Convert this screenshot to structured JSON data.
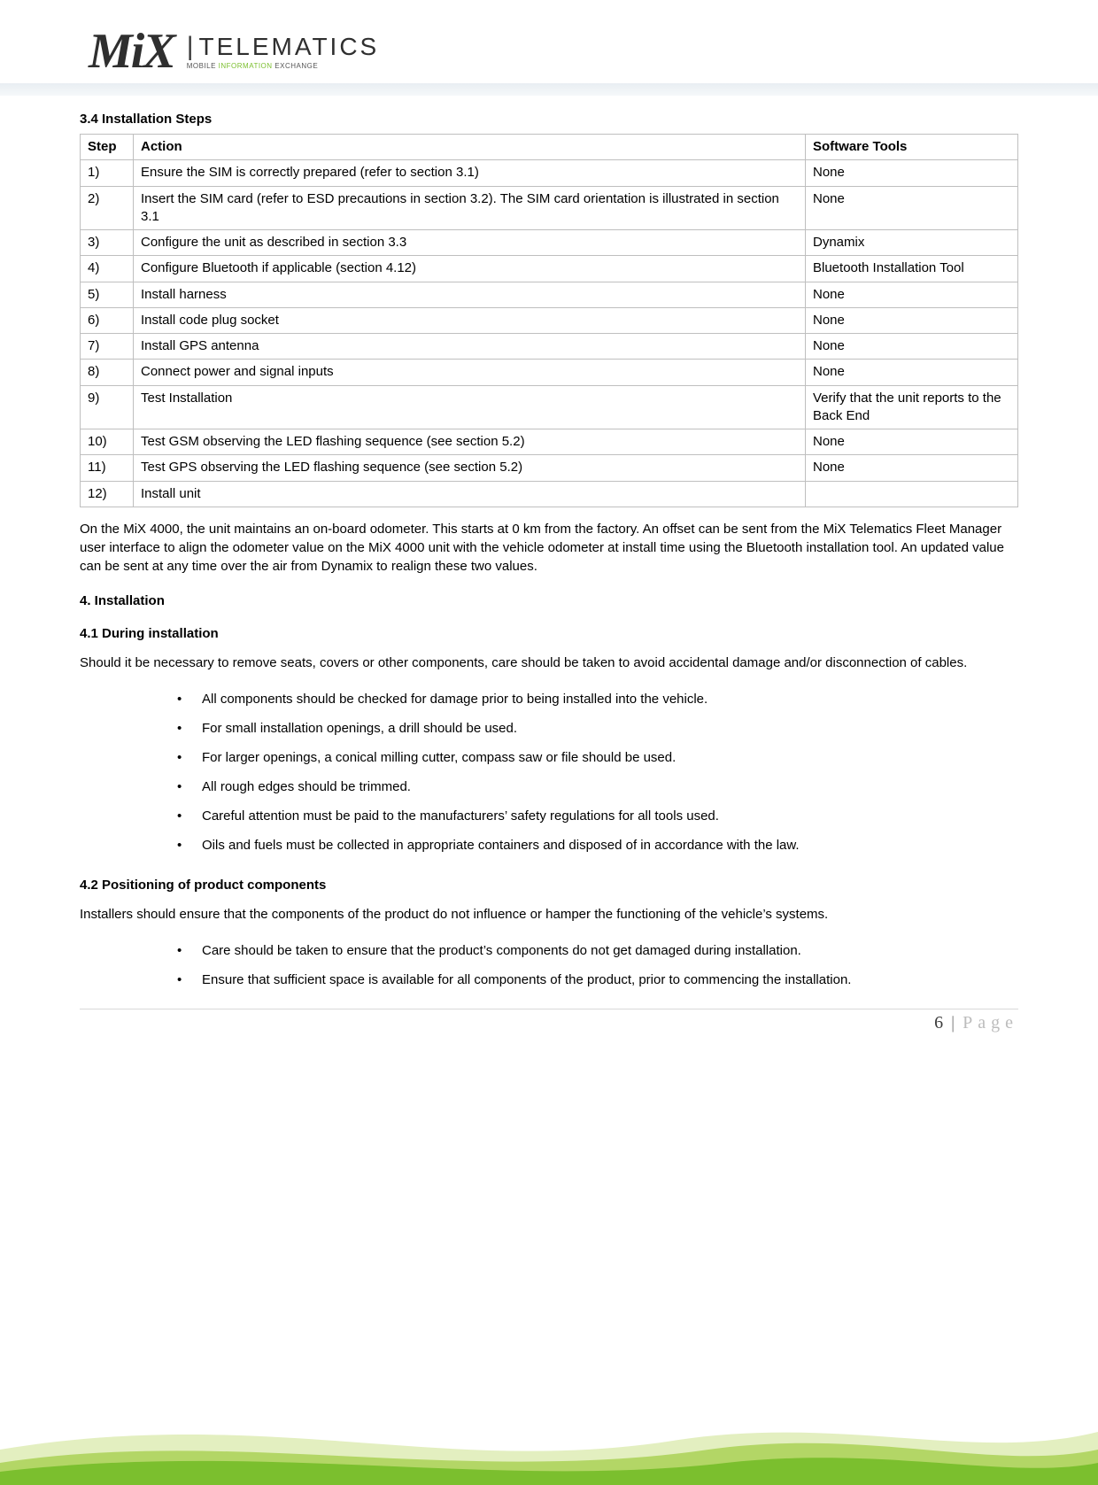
{
  "logo": {
    "mix": "MiX",
    "telematics": "TELEMATICS",
    "tagline_pre": "MOBILE ",
    "tagline_green": "INFORMATION",
    "tagline_post": " EXCHANGE"
  },
  "section_3_4": {
    "heading": "3.4  Installation Steps",
    "columns": {
      "step": "Step",
      "action": "Action",
      "tool": "Software Tools"
    },
    "rows": [
      {
        "step": "1)",
        "action": "Ensure the SIM is correctly prepared (refer to section 3.1)",
        "tool": "None"
      },
      {
        "step": "2)",
        "action": "Insert the SIM card (refer to ESD precautions in section 3.2).  The SIM card orientation is illustrated in section 3.1",
        "tool": "None"
      },
      {
        "step": "3)",
        "action": "Configure the unit as described in section 3.3",
        "tool": "Dynamix"
      },
      {
        "step": "4)",
        "action": "Configure Bluetooth if applicable (section 4.12)",
        "tool": "Bluetooth Installation Tool"
      },
      {
        "step": "5)",
        "action": "Install harness",
        "tool": "None"
      },
      {
        "step": "6)",
        "action": "Install code plug socket",
        "tool": "None"
      },
      {
        "step": "7)",
        "action": "Install GPS antenna",
        "tool": "None"
      },
      {
        "step": "8)",
        "action": "Connect power and signal inputs",
        "tool": "None"
      },
      {
        "step": "9)",
        "action": "Test Installation",
        "tool": "Verify that the unit reports to the Back End"
      },
      {
        "step": "10)",
        "action": "Test GSM observing the LED flashing sequence (see section 5.2)",
        "tool": "None"
      },
      {
        "step": "11)",
        "action": "Test GPS observing the LED flashing sequence (see section 5.2)",
        "tool": "None"
      },
      {
        "step": "12)",
        "action": "Install unit",
        "tool": ""
      }
    ],
    "followup": "On the MiX 4000, the unit maintains an on-board odometer. This starts at 0 km from the factory. An offset can be sent from the MiX Telematics Fleet Manager user interface to align the odometer value on the MiX 4000 unit with the vehicle odometer at install time using the Bluetooth installation tool. An updated value can be sent at any time over the air from Dynamix to realign these two values."
  },
  "section_4": {
    "heading": "4.  Installation"
  },
  "section_4_1": {
    "heading": "4.1  During installation",
    "intro": "Should it be necessary to remove seats, covers or other components, care should be taken to avoid accidental damage and/or disconnection of cables.",
    "bullets": [
      "All components should be checked for damage prior to being installed into the vehicle.",
      "For small installation openings, a drill should be used.",
      "For larger openings, a conical milling cutter, compass saw or file should be used.",
      "All rough edges should be trimmed.",
      "Careful attention must be paid to the manufacturers’ safety regulations for all tools used.",
      "Oils and fuels must be collected in appropriate containers and disposed of in accordance with the law."
    ]
  },
  "section_4_2": {
    "heading": "4.2  Positioning of product components",
    "intro": "Installers should ensure that the components of the product do not influence or hamper the functioning of the vehicle’s systems.",
    "bullets": [
      "Care should be taken to ensure that the product’s components do not get damaged during installation.",
      "Ensure that sufficient space is available for all components of the product, prior to commencing the installation."
    ]
  },
  "footer": {
    "page_num": "6",
    "sep": "|",
    "page_word": "Page"
  }
}
